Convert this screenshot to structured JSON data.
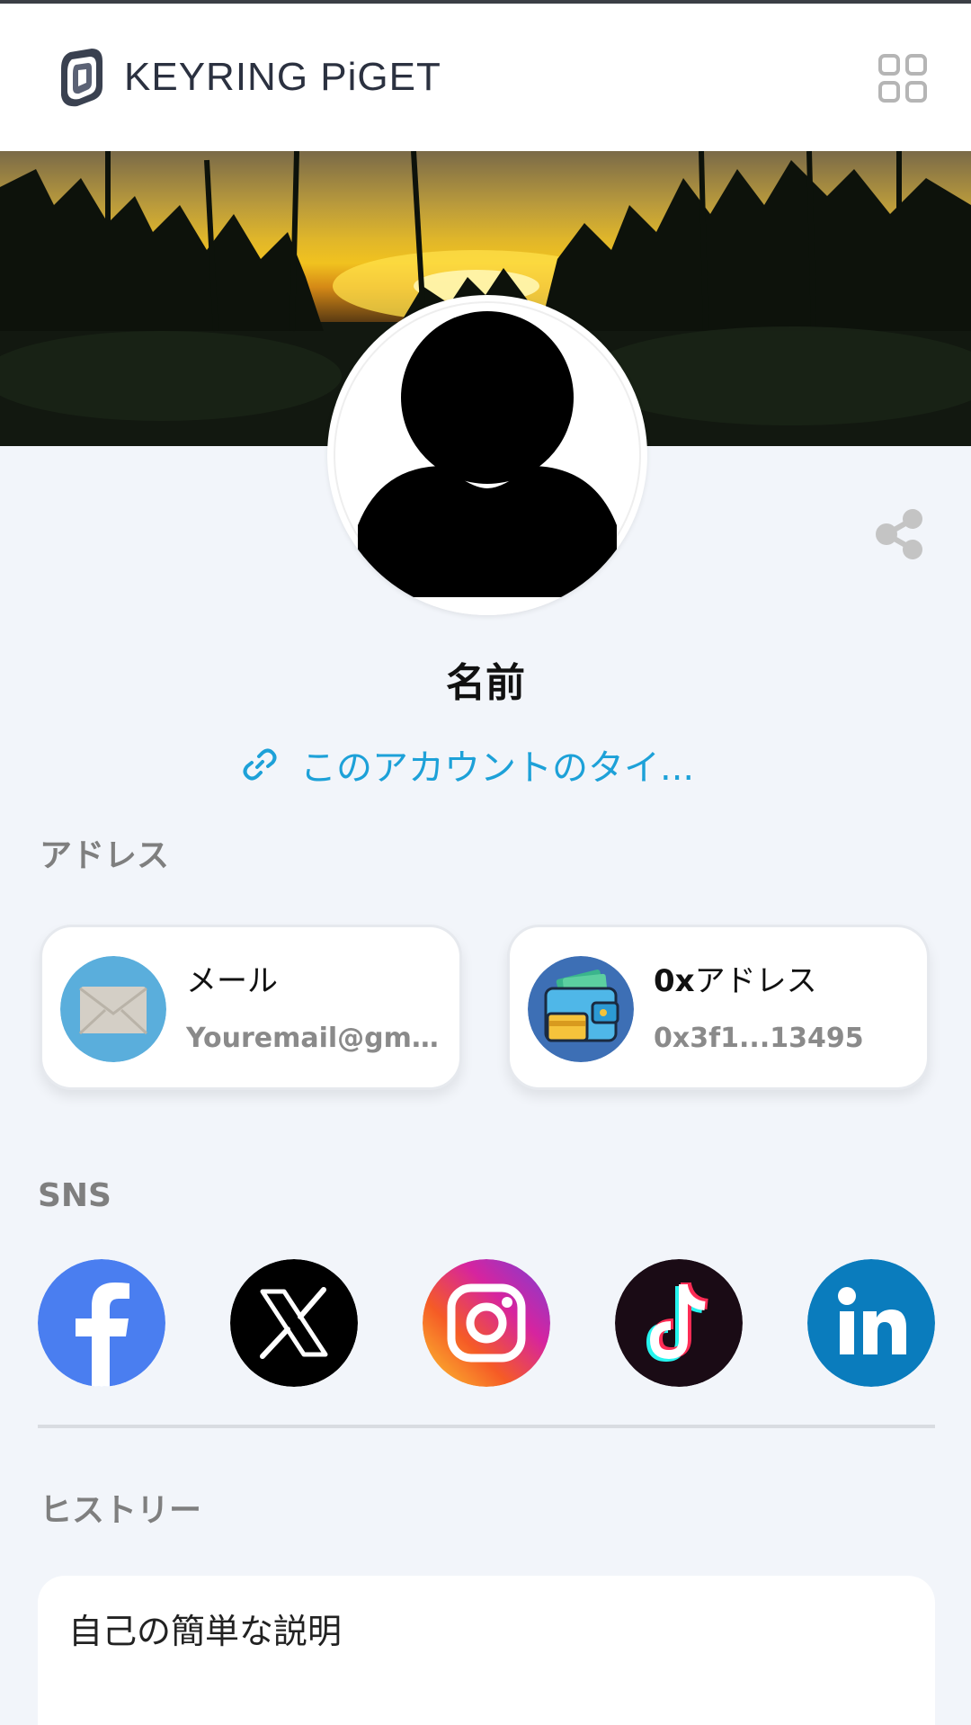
{
  "header": {
    "brand": "KEYRING PiGET",
    "logo_icon": "keyring-logo-icon",
    "menu_icon": "grid-icon"
  },
  "profile": {
    "name": "名前",
    "title_link": "このアカウントのタイ...",
    "link_icon": "link-icon",
    "share_icon": "share-icon",
    "avatar_icon": "default-avatar-icon"
  },
  "address": {
    "label": "アドレス",
    "cards": [
      {
        "title": "メール",
        "value": "Youremail@gma...",
        "icon": "envelope-icon"
      },
      {
        "title_prefix": "0x",
        "title_suffix": "アドレス",
        "value": "0x3f1...13495",
        "icon": "wallet-icon"
      }
    ]
  },
  "sns": {
    "label": "SNS",
    "items": [
      {
        "name": "Facebook",
        "icon": "facebook-icon",
        "color": "#4a7ef0"
      },
      {
        "name": "X",
        "icon": "x-icon",
        "color": "#000000"
      },
      {
        "name": "Instagram",
        "icon": "instagram-icon",
        "color": "#d6249f"
      },
      {
        "name": "TikTok",
        "icon": "tiktok-icon",
        "color": "#1a0b15"
      },
      {
        "name": "LinkedIn",
        "icon": "linkedin-icon",
        "color": "#0a7cbd"
      }
    ]
  },
  "history": {
    "label": "ヒストリー",
    "description": "自己の簡単な説明"
  },
  "colors": {
    "accent": "#1da1d8",
    "background": "#f2f5fa",
    "label_gray": "#7f7f7f"
  }
}
